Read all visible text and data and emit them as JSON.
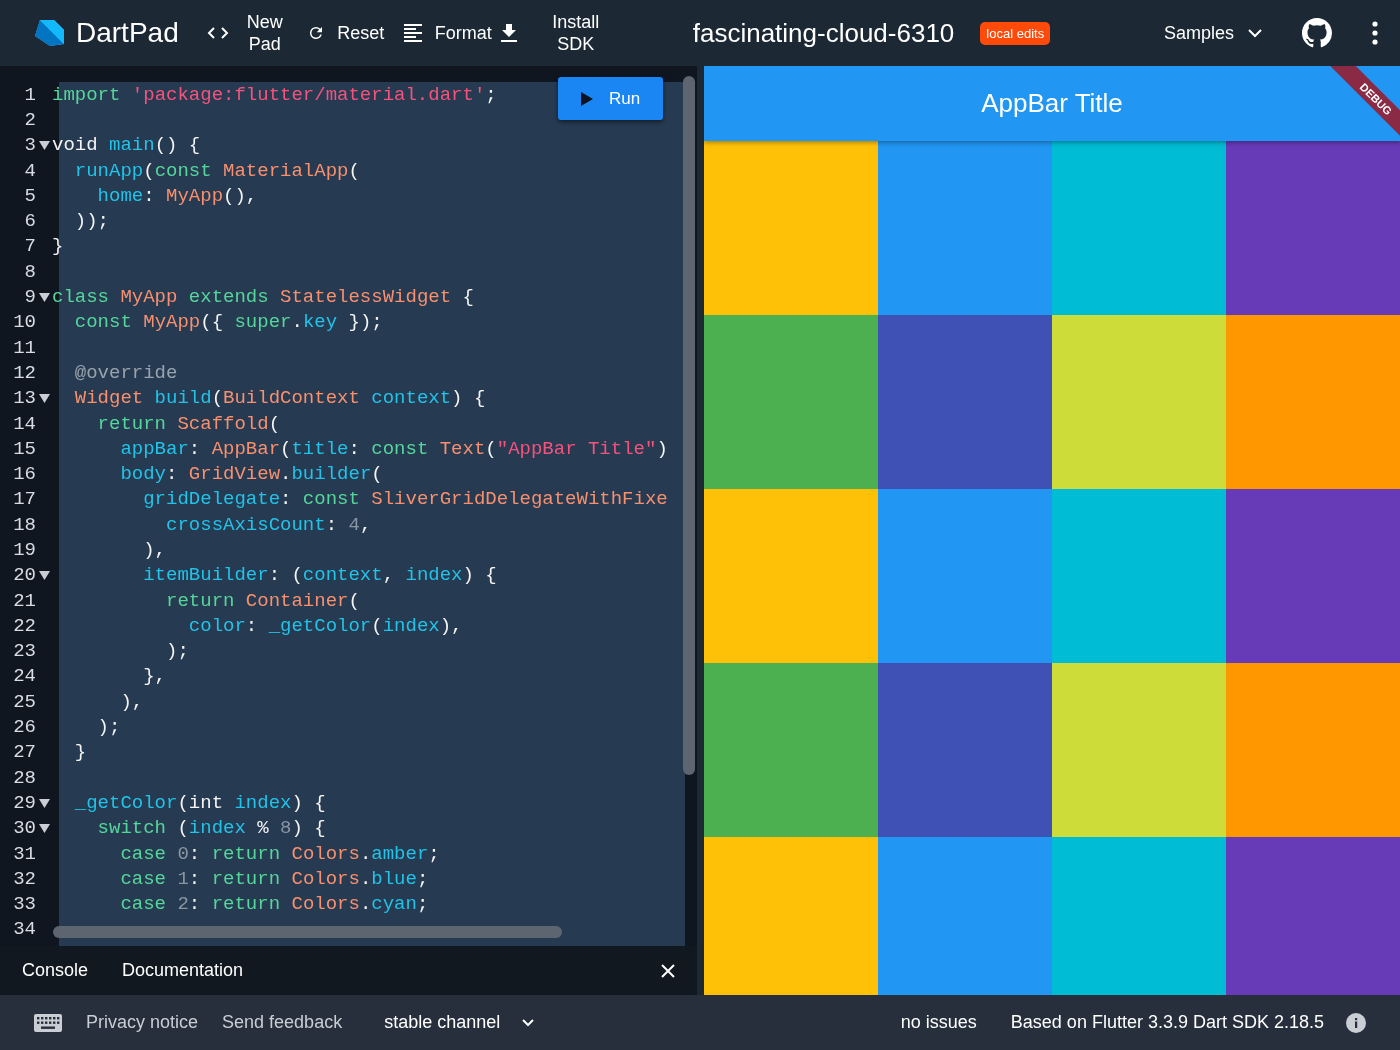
{
  "header": {
    "app_name": "DartPad",
    "actions": [
      {
        "kind": "code",
        "label": "New Pad"
      },
      {
        "kind": "reset",
        "label": "Reset"
      },
      {
        "kind": "format",
        "label": "Format"
      },
      {
        "kind": "download",
        "label": "Install SDK"
      }
    ],
    "title": "fascinating-cloud-6310",
    "badge": "local edits",
    "samples": "Samples"
  },
  "editor": {
    "run_label": "Run",
    "lines": [
      {
        "n": "1",
        "fold": false,
        "tokens": [
          {
            "text": "import",
            "kind": "kw"
          },
          {
            "text": " 'package:flutter/material.dart'",
            "kind": "str"
          },
          {
            "text": ";",
            "kind": "plain"
          }
        ]
      },
      {
        "n": "2",
        "fold": false
      },
      {
        "n": "3",
        "fold": true,
        "tokens": [
          {
            "text": "void ",
            "kind": "plain"
          },
          {
            "text": "main",
            "kind": "fn"
          },
          {
            "text": "() {",
            "kind": "plain"
          }
        ]
      },
      {
        "n": "4",
        "fold": false,
        "tokens": [
          {
            "text": "  runApp",
            "kind": "fn"
          },
          {
            "text": "(",
            "kind": "plain"
          },
          {
            "text": "const",
            "kind": "kw"
          },
          {
            "text": " MaterialApp",
            "kind": "type"
          },
          {
            "text": "(",
            "kind": "plain"
          }
        ]
      },
      {
        "n": "5",
        "fold": false,
        "tokens": [
          {
            "text": "    home",
            "kind": "fn"
          },
          {
            "text": ": ",
            "kind": "plain"
          },
          {
            "text": "MyApp",
            "kind": "type"
          },
          {
            "text": "(),",
            "kind": "plain"
          }
        ]
      },
      {
        "n": "6",
        "fold": false,
        "tokens": [
          {
            "text": "  ));",
            "kind": "plain"
          }
        ]
      },
      {
        "n": "7",
        "fold": false,
        "tokens": [
          {
            "text": "}",
            "kind": "plain"
          }
        ]
      },
      {
        "n": "8",
        "fold": false
      },
      {
        "n": "9",
        "fold": true,
        "tokens": [
          {
            "text": "class",
            "kind": "kw"
          },
          {
            "text": " MyApp",
            "kind": "type"
          },
          {
            "text": " extends",
            "kind": "kw"
          },
          {
            "text": " StatelessWidget",
            "kind": "type"
          },
          {
            "text": " {",
            "kind": "plain"
          }
        ]
      },
      {
        "n": "10",
        "fold": false,
        "tokens": [
          {
            "text": "  const",
            "kind": "kw"
          },
          {
            "text": " MyApp",
            "kind": "type"
          },
          {
            "text": "({ ",
            "kind": "plain"
          },
          {
            "text": "super",
            "kind": "kw"
          },
          {
            "text": ".",
            "kind": "plain"
          },
          {
            "text": "key",
            "kind": "fn"
          },
          {
            "text": " });",
            "kind": "plain"
          }
        ]
      },
      {
        "n": "11",
        "fold": false
      },
      {
        "n": "12",
        "fold": false,
        "tokens": [
          {
            "text": "  @override",
            "kind": "meta"
          }
        ]
      },
      {
        "n": "13",
        "fold": true,
        "tokens": [
          {
            "text": "  Widget",
            "kind": "type"
          },
          {
            "text": " build",
            "kind": "fn"
          },
          {
            "text": "(",
            "kind": "plain"
          },
          {
            "text": "BuildContext",
            "kind": "type"
          },
          {
            "text": " context",
            "kind": "fn"
          },
          {
            "text": ") {",
            "kind": "plain"
          }
        ]
      },
      {
        "n": "14",
        "fold": false,
        "tokens": [
          {
            "text": "    return",
            "kind": "kw"
          },
          {
            "text": " Scaffold",
            "kind": "type"
          },
          {
            "text": "(",
            "kind": "plain"
          }
        ]
      },
      {
        "n": "15",
        "fold": false,
        "tokens": [
          {
            "text": "      appBar",
            "kind": "fn"
          },
          {
            "text": ": ",
            "kind": "plain"
          },
          {
            "text": "AppBar",
            "kind": "type"
          },
          {
            "text": "(",
            "kind": "plain"
          },
          {
            "text": "title",
            "kind": "fn"
          },
          {
            "text": ": ",
            "kind": "plain"
          },
          {
            "text": "const",
            "kind": "kw"
          },
          {
            "text": " Text",
            "kind": "type"
          },
          {
            "text": "(",
            "kind": "plain"
          },
          {
            "text": "\"AppBar Title\"",
            "kind": "str"
          },
          {
            "text": ")",
            "kind": "plain"
          }
        ]
      },
      {
        "n": "16",
        "fold": false,
        "tokens": [
          {
            "text": "      body",
            "kind": "fn"
          },
          {
            "text": ": ",
            "kind": "plain"
          },
          {
            "text": "GridView",
            "kind": "type"
          },
          {
            "text": ".",
            "kind": "plain"
          },
          {
            "text": "builder",
            "kind": "fn"
          },
          {
            "text": "(",
            "kind": "plain"
          }
        ]
      },
      {
        "n": "17",
        "fold": false,
        "tokens": [
          {
            "text": "        gridDelegate",
            "kind": "fn"
          },
          {
            "text": ": ",
            "kind": "plain"
          },
          {
            "text": "const",
            "kind": "kw"
          },
          {
            "text": " SliverGridDelegateWithFixe",
            "kind": "type"
          }
        ]
      },
      {
        "n": "18",
        "fold": false,
        "tokens": [
          {
            "text": "          crossAxisCount",
            "kind": "fn"
          },
          {
            "text": ": ",
            "kind": "plain"
          },
          {
            "text": "4",
            "kind": "num"
          },
          {
            "text": ",",
            "kind": "plain"
          }
        ]
      },
      {
        "n": "19",
        "fold": false,
        "tokens": [
          {
            "text": "        ),",
            "kind": "plain"
          }
        ]
      },
      {
        "n": "20",
        "fold": true,
        "tokens": [
          {
            "text": "        itemBuilder",
            "kind": "fn"
          },
          {
            "text": ": (",
            "kind": "plain"
          },
          {
            "text": "context",
            "kind": "fn"
          },
          {
            "text": ", ",
            "kind": "plain"
          },
          {
            "text": "index",
            "kind": "fn"
          },
          {
            "text": ") {",
            "kind": "plain"
          }
        ]
      },
      {
        "n": "21",
        "fold": false,
        "tokens": [
          {
            "text": "          return",
            "kind": "kw"
          },
          {
            "text": " Container",
            "kind": "type"
          },
          {
            "text": "(",
            "kind": "plain"
          }
        ]
      },
      {
        "n": "22",
        "fold": false,
        "tokens": [
          {
            "text": "            color",
            "kind": "fn"
          },
          {
            "text": ": ",
            "kind": "plain"
          },
          {
            "text": "_getColor",
            "kind": "fn"
          },
          {
            "text": "(",
            "kind": "plain"
          },
          {
            "text": "index",
            "kind": "fn"
          },
          {
            "text": "),",
            "kind": "plain"
          }
        ]
      },
      {
        "n": "23",
        "fold": false,
        "tokens": [
          {
            "text": "          );",
            "kind": "plain"
          }
        ]
      },
      {
        "n": "24",
        "fold": false,
        "tokens": [
          {
            "text": "        },",
            "kind": "plain"
          }
        ]
      },
      {
        "n": "25",
        "fold": false,
        "tokens": [
          {
            "text": "      ),",
            "kind": "plain"
          }
        ]
      },
      {
        "n": "26",
        "fold": false,
        "tokens": [
          {
            "text": "    );",
            "kind": "plain"
          }
        ]
      },
      {
        "n": "27",
        "fold": false,
        "tokens": [
          {
            "text": "  }",
            "kind": "plain"
          }
        ]
      },
      {
        "n": "28",
        "fold": false
      },
      {
        "n": "29",
        "fold": true,
        "tokens": [
          {
            "text": "  _getColor",
            "kind": "fn"
          },
          {
            "text": "(int ",
            "kind": "plain"
          },
          {
            "text": "index",
            "kind": "fn"
          },
          {
            "text": ") {",
            "kind": "plain"
          }
        ]
      },
      {
        "n": "30",
        "fold": true,
        "tokens": [
          {
            "text": "    switch",
            "kind": "kw"
          },
          {
            "text": " (",
            "kind": "plain"
          },
          {
            "text": "index",
            "kind": "fn"
          },
          {
            "text": " % ",
            "kind": "plain"
          },
          {
            "text": "8",
            "kind": "num"
          },
          {
            "text": ") {",
            "kind": "plain"
          }
        ]
      },
      {
        "n": "31",
        "fold": false,
        "tokens": [
          {
            "text": "      case",
            "kind": "kw"
          },
          {
            "text": " 0",
            "kind": "num"
          },
          {
            "text": ": ",
            "kind": "plain"
          },
          {
            "text": "return",
            "kind": "kw"
          },
          {
            "text": " Colors",
            "kind": "type"
          },
          {
            "text": ".",
            "kind": "plain"
          },
          {
            "text": "amber",
            "kind": "fn"
          },
          {
            "text": ";",
            "kind": "plain"
          }
        ]
      },
      {
        "n": "32",
        "fold": false,
        "tokens": [
          {
            "text": "      case",
            "kind": "kw"
          },
          {
            "text": " 1",
            "kind": "num"
          },
          {
            "text": ": ",
            "kind": "plain"
          },
          {
            "text": "return",
            "kind": "kw"
          },
          {
            "text": " Colors",
            "kind": "type"
          },
          {
            "text": ".",
            "kind": "plain"
          },
          {
            "text": "blue",
            "kind": "fn"
          },
          {
            "text": ";",
            "kind": "plain"
          }
        ]
      },
      {
        "n": "33",
        "fold": false,
        "tokens": [
          {
            "text": "      case",
            "kind": "kw"
          },
          {
            "text": " 2",
            "kind": "num"
          },
          {
            "text": ": ",
            "kind": "plain"
          },
          {
            "text": "return",
            "kind": "kw"
          },
          {
            "text": " Colors",
            "kind": "type"
          },
          {
            "text": ".",
            "kind": "plain"
          },
          {
            "text": "cyan",
            "kind": "fn"
          },
          {
            "text": ";",
            "kind": "plain"
          }
        ]
      },
      {
        "n": "34",
        "fold": false
      }
    ]
  },
  "console": {
    "tabs": [
      "Console",
      "Documentation"
    ]
  },
  "preview": {
    "appbar_title": "AppBar Title",
    "banner": "DEBUG",
    "cells": [
      {
        "color": "#ffc107"
      },
      {
        "color": "#2196f3"
      },
      {
        "color": "#00bcd4"
      },
      {
        "color": "#673ab7"
      },
      {
        "color": "#4caf50"
      },
      {
        "color": "#3f51b5"
      },
      {
        "color": "#cddc39"
      },
      {
        "color": "#ff9800"
      },
      {
        "color": "#ffc107"
      },
      {
        "color": "#2196f3"
      },
      {
        "color": "#00bcd4"
      },
      {
        "color": "#673ab7"
      },
      {
        "color": "#4caf50"
      },
      {
        "color": "#3f51b5"
      },
      {
        "color": "#cddc39"
      },
      {
        "color": "#ff9800"
      },
      {
        "color": "#ffc107"
      },
      {
        "color": "#2196f3"
      },
      {
        "color": "#00bcd4"
      },
      {
        "color": "#673ab7"
      }
    ]
  },
  "status_bar": {
    "links": [
      "Privacy notice",
      "Send feedback"
    ],
    "channel": "stable channel",
    "issues": "no issues",
    "version": "Based on Flutter 3.3.9 Dart SDK 2.18.5"
  }
}
